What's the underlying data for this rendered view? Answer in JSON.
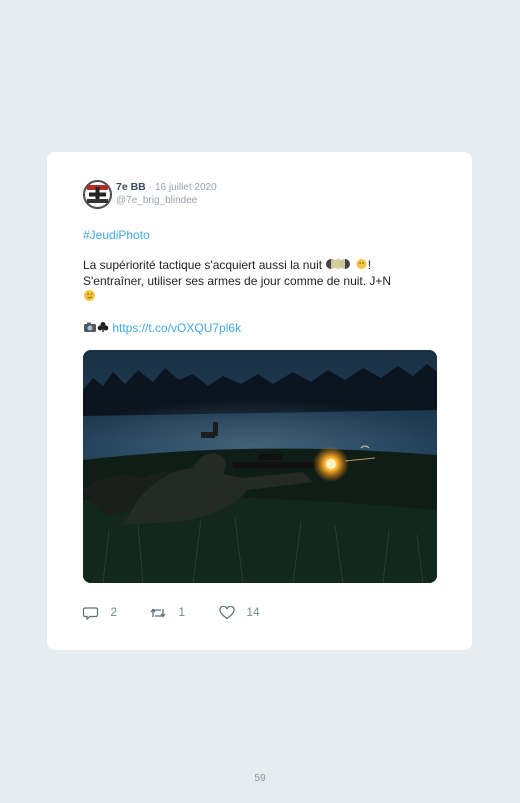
{
  "tweet": {
    "author_name": "7e BB",
    "separator": "·",
    "date": "16 juillet 2020",
    "handle": "@7e_brig_blindee",
    "hashtag": "#JeudiPhoto",
    "line1": "La supériorité tactique s'acquiert aussi la nuit",
    "line1_suffix": "!",
    "line2": "S'entraîner, utiliser ses armes de jour comme de nuit. J+N",
    "link": "https://t.co/vOXQU7pl6k",
    "photo_alt": "night-fire-training-photo"
  },
  "actions": {
    "replies": "2",
    "retweets": "1",
    "likes": "14"
  },
  "colors": {
    "background": "#e6ecef",
    "card": "#ffffff",
    "link": "#3fa8e6",
    "muted": "#98a2ab"
  },
  "page": {
    "number": "59"
  }
}
